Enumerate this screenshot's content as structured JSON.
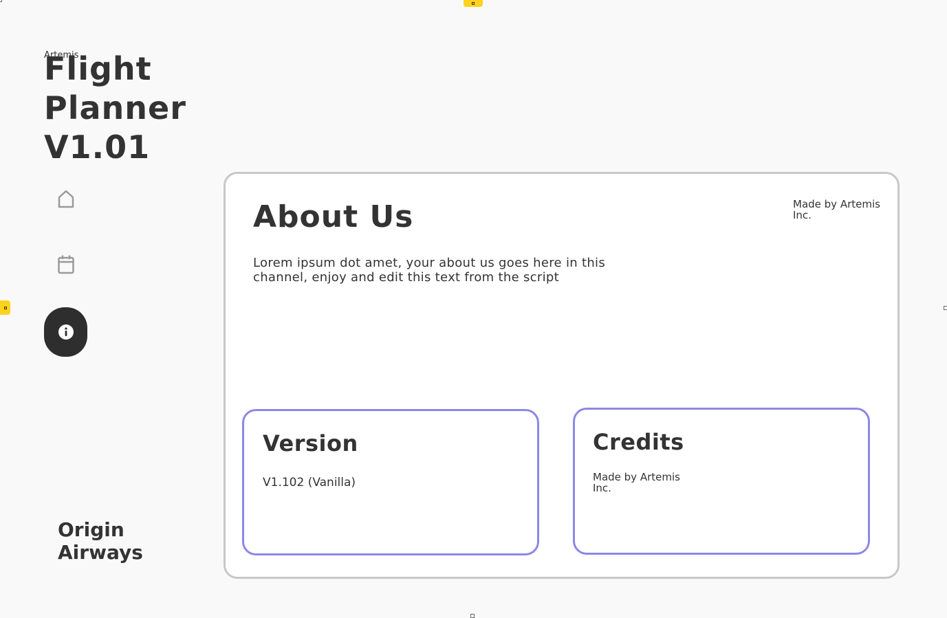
{
  "sidebar": {
    "brand_small": "Artemis",
    "title": "Flight Planner V1.01",
    "nav": [
      {
        "icon": "home-icon"
      },
      {
        "icon": "calendar-icon"
      },
      {
        "icon": "info-icon",
        "active": true
      }
    ],
    "airline": "Origin Airways"
  },
  "main": {
    "title": "About Us",
    "body": "Lorem ipsum dot amet, your about us goes here in this channel, enjoy and edit this text from the script",
    "credit": "Made by Artemis Inc.",
    "cards": {
      "version": {
        "title": "Version",
        "text": "V1.102 (Vanilla)"
      },
      "credits": {
        "title": "Credits",
        "text": "Made by Artemis Inc."
      }
    }
  },
  "colors": {
    "background": "#f9f9f9",
    "text": "#333333",
    "card_border": "#8b88e6",
    "panel_border": "#c8c8c8",
    "active_nav": "#2e2e2e",
    "handle": "#ffd21f"
  }
}
